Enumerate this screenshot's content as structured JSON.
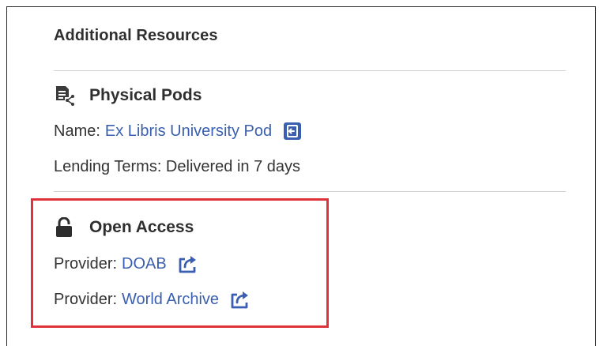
{
  "section": {
    "title": "Additional Resources"
  },
  "physical_pods": {
    "heading": "Physical Pods",
    "icon": "document-share-icon",
    "name_label": "Name:",
    "name_value": "Ex Libris University Pod",
    "name_link_icon": "login-arrow-icon",
    "lending_text": "Lending Terms: Delivered in 7 days"
  },
  "open_access": {
    "heading": "Open Access",
    "icon": "unlocked-padlock-icon",
    "providers": [
      {
        "label": "Provider:",
        "value": "DOAB",
        "icon": "external-share-icon"
      },
      {
        "label": "Provider:",
        "value": "World Archive",
        "icon": "external-share-icon"
      }
    ]
  },
  "colors": {
    "link": "#3a5fb0",
    "highlight": "#e0323b",
    "text": "#333333"
  }
}
